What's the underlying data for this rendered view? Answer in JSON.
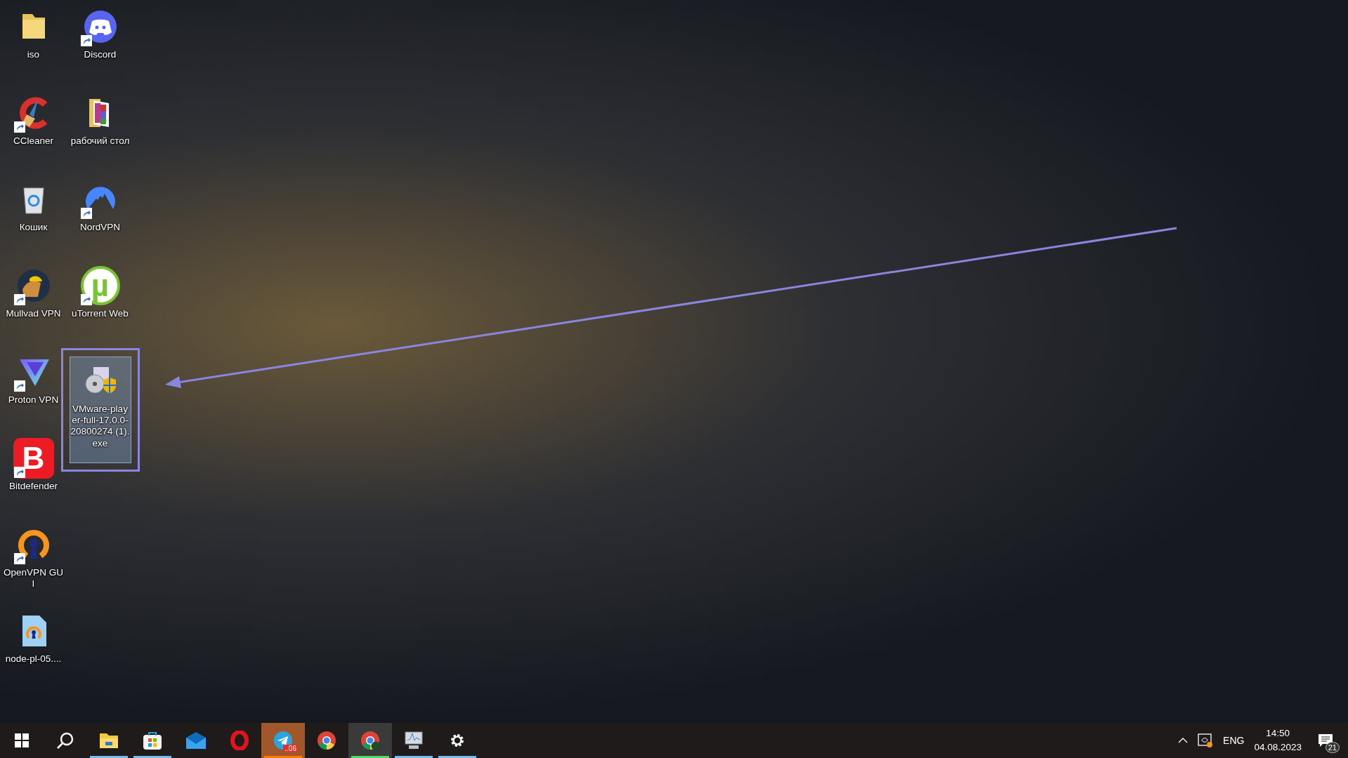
{
  "desktop": {
    "icons": [
      {
        "label": "iso",
        "shortcut": false,
        "selected": false
      },
      {
        "label": "CCleaner",
        "shortcut": true,
        "selected": false
      },
      {
        "label": "Кошик",
        "shortcut": false,
        "selected": false
      },
      {
        "label": "Mullvad VPN",
        "shortcut": true,
        "selected": false
      },
      {
        "label": "Proton VPN",
        "shortcut": true,
        "selected": false
      },
      {
        "label": "Bitdefender",
        "shortcut": true,
        "selected": false,
        "logo_text": "B"
      },
      {
        "label": "OpenVPN GUI",
        "shortcut": true,
        "selected": false
      },
      {
        "label": "node-pl-05....",
        "shortcut": false,
        "selected": false
      },
      {
        "label": "Discord",
        "shortcut": true,
        "selected": false
      },
      {
        "label": "рабочий стол",
        "shortcut": false,
        "selected": false
      },
      {
        "label": "NordVPN",
        "shortcut": true,
        "selected": false
      },
      {
        "label": "uTorrent Web",
        "shortcut": true,
        "selected": false,
        "logo_text": "µ"
      },
      {
        "label": "VMware-player-full-17.0.0-20800274 (1).exe",
        "shortcut": false,
        "selected": true
      }
    ]
  },
  "taskbar": {
    "items": [
      {
        "active": false
      },
      {
        "active": false
      },
      {
        "active": false,
        "color": "#76b9ed"
      },
      {
        "active": false,
        "color": "#76b9ed"
      },
      {
        "active": false
      },
      {
        "active": false
      },
      {
        "active": true,
        "color": "#ff7a00",
        "badge": "..06"
      },
      {
        "active": false
      },
      {
        "active": true,
        "color": "#4cd964"
      },
      {
        "active": false,
        "color": "#76b9ed"
      },
      {
        "active": false,
        "color": "#76b9ed"
      }
    ],
    "tray": {
      "language": "ENG",
      "time": "14:50",
      "date": "04.08.2023",
      "notifications": "21"
    }
  }
}
